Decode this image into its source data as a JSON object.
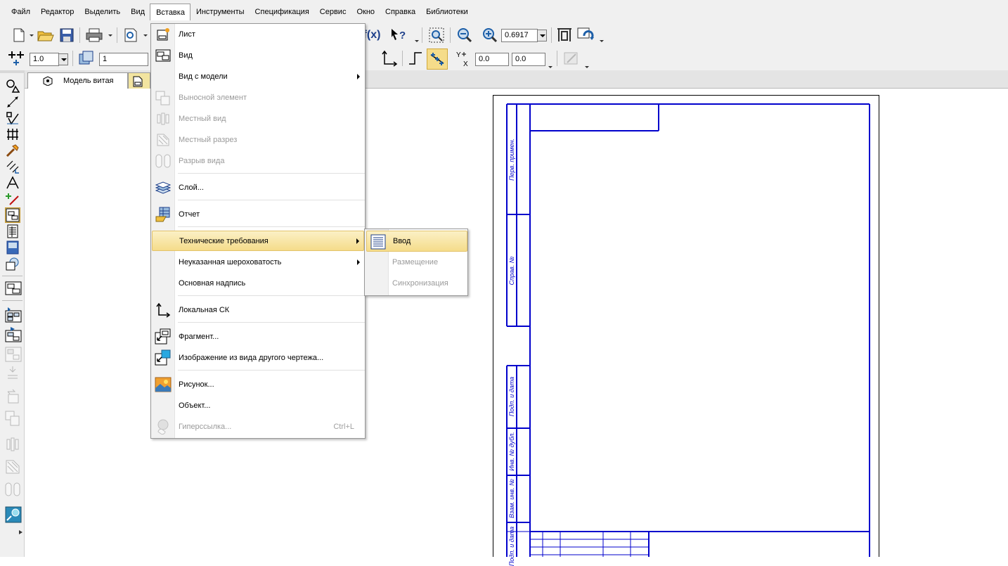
{
  "menubar": {
    "items": [
      "Файл",
      "Редактор",
      "Выделить",
      "Вид",
      "Вставка",
      "Инструменты",
      "Спецификация",
      "Сервис",
      "Окно",
      "Справка",
      "Библиотеки"
    ],
    "active": "Вставка"
  },
  "toolbar": {
    "zoom_value": "0.6917",
    "line_scale": "1.0",
    "layer_value": "1",
    "coord_x": "0.0",
    "coord_y": "0.0",
    "fx_label": "f(x)"
  },
  "tabs": {
    "model_tab_label": "Модель витая"
  },
  "insert_menu": {
    "items": [
      {
        "label": "Лист",
        "icon": "sheet-icon",
        "enabled": true
      },
      {
        "label": "Вид",
        "icon": "view-icon",
        "enabled": true
      },
      {
        "label": "Вид с модели",
        "icon": "",
        "enabled": true,
        "submenu": true
      },
      {
        "label": "Выносной элемент",
        "icon": "detail-element-icon",
        "enabled": false
      },
      {
        "label": "Местный вид",
        "icon": "local-view-icon",
        "enabled": false
      },
      {
        "label": "Местный разрез",
        "icon": "local-section-icon",
        "enabled": false
      },
      {
        "label": "Разрыв вида",
        "icon": "view-break-icon",
        "enabled": false
      },
      {
        "label": "Слой...",
        "icon": "layer-icon",
        "enabled": true
      },
      {
        "label": "Отчет",
        "icon": "report-icon",
        "enabled": true
      },
      {
        "label": "Технические требования",
        "icon": "",
        "enabled": true,
        "submenu": true,
        "highlighted": true
      },
      {
        "label": "Неуказанная шероховатость",
        "icon": "",
        "enabled": true,
        "submenu": true
      },
      {
        "label": "Основная надпись",
        "icon": "",
        "enabled": true
      },
      {
        "label": "Локальная СК",
        "icon": "local-cs-icon",
        "enabled": true
      },
      {
        "label": "Фрагмент...",
        "icon": "fragment-icon",
        "enabled": true
      },
      {
        "label": "Изображение из вида другого чертежа...",
        "icon": "image-from-view-icon",
        "enabled": true
      },
      {
        "label": "Рисунок...",
        "icon": "picture-icon",
        "enabled": true
      },
      {
        "label": "Объект...",
        "icon": "",
        "enabled": true
      },
      {
        "label": "Гиперссылка...",
        "icon": "hyperlink-icon",
        "enabled": false,
        "shortcut": "Ctrl+L"
      }
    ]
  },
  "tech_req_submenu": {
    "items": [
      {
        "label": "Ввод",
        "enabled": true,
        "highlighted": true,
        "icon": "text-input-icon"
      },
      {
        "label": "Размещение",
        "enabled": false
      },
      {
        "label": "Синхронизация",
        "enabled": false
      }
    ]
  },
  "drawing": {
    "stamp_labels": [
      "Перв. примен.",
      "Справ. №",
      "Подп. и дата",
      "Инв. № дубл.",
      "Взам. инв. №",
      "Подп. и дата"
    ]
  },
  "colors": {
    "frame_blue": "#0000cc",
    "highlight": "#f5dc8a"
  }
}
